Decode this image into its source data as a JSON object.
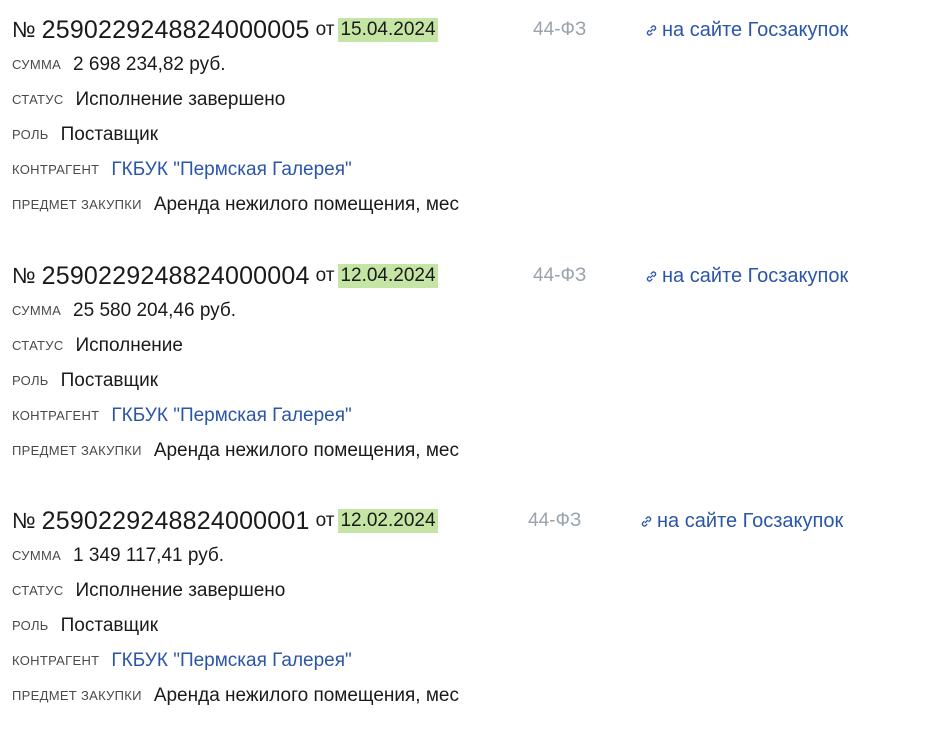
{
  "labels": {
    "number_sign": "№",
    "from": "от",
    "sum": "сумма",
    "status": "статус",
    "role": "роль",
    "counterparty": "контрагент",
    "subject": "предмет закупки"
  },
  "contracts": [
    {
      "number": "2590229248824000005",
      "date": "15.04.2024",
      "law": "44-ФЗ",
      "link_text": "на сайте Госзакупок",
      "sum": "2 698 234,82 руб.",
      "status": "Исполнение завершено",
      "role": "Поставщик",
      "counterparty": "ГКБУК \"Пермская Галерея\"",
      "subject": "Аренда нежилого помещения, мес"
    },
    {
      "number": "2590229248824000004",
      "date": "12.04.2024",
      "law": "44-ФЗ",
      "link_text": "на сайте Госзакупок",
      "sum": "25 580 204,46 руб.",
      "status": "Исполнение",
      "role": "Поставщик",
      "counterparty": "ГКБУК \"Пермская Галерея\"",
      "subject": "Аренда нежилого помещения, мес"
    },
    {
      "number": "2590229248824000001",
      "date": "12.02.2024",
      "law": "44-ФЗ",
      "link_text": "на сайте Госзакупок",
      "sum": "1 349 117,41 руб.",
      "status": "Исполнение завершено",
      "role": "Поставщик",
      "counterparty": "ГКБУК \"Пермская Галерея\"",
      "subject": "Аренда нежилого помещения, мес"
    }
  ],
  "colors": {
    "link": "#2b55a8",
    "date_highlight": "#c5e5a5",
    "law_text": "#9aa3ad"
  },
  "icons": {
    "link": "link-icon"
  }
}
